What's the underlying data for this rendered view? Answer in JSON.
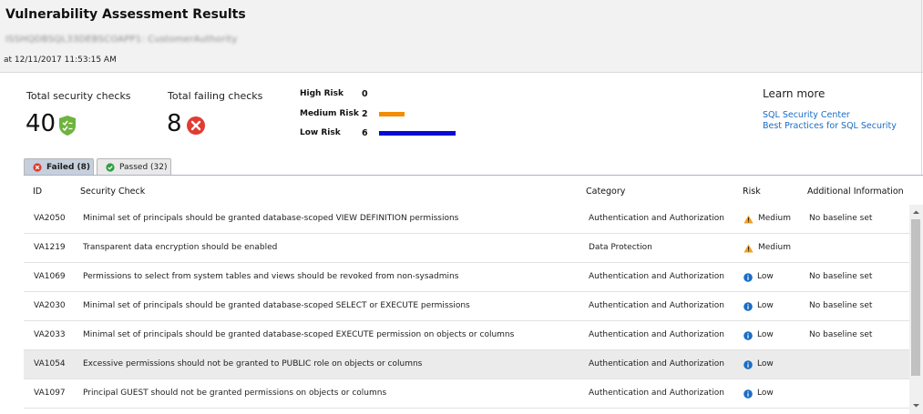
{
  "header": {
    "title": "Vulnerability Assessment Results",
    "server": "ISSHQDBSQL33DEBSCOAPP1: CustomerAuthority",
    "timestamp": "at 12/11/2017 11:53:15 AM"
  },
  "summary": {
    "total_label": "Total security checks",
    "total_value": "40",
    "failing_label": "Total failing checks",
    "failing_value": "8"
  },
  "risk_breakdown": [
    {
      "label": "High Risk",
      "count": "0",
      "value": 0,
      "color": "#e8862a"
    },
    {
      "label": "Medium Risk",
      "count": "2",
      "value": 2,
      "color": "#f28c00"
    },
    {
      "label": "Low Risk",
      "count": "6",
      "value": 6,
      "color": "#0a0ad6"
    }
  ],
  "learn_more": {
    "title": "Learn more",
    "links": [
      "SQL Security Center",
      "Best Practices for SQL Security"
    ]
  },
  "tabs": {
    "failed": "Failed (8)",
    "passed": "Passed (32)",
    "active": "failed"
  },
  "table": {
    "columns": {
      "id": "ID",
      "check": "Security Check",
      "category": "Category",
      "risk": "Risk",
      "info": "Additional Information"
    },
    "rows": [
      {
        "id": "VA2050",
        "check": "Minimal set of principals should be granted database-scoped VIEW DEFINITION permissions",
        "category": "Authentication and Authorization",
        "risk": "Medium",
        "risk_icon": "warning-icon",
        "info": "No baseline set"
      },
      {
        "id": "VA1219",
        "check": "Transparent data encryption should be enabled",
        "category": "Data Protection",
        "risk": "Medium",
        "risk_icon": "warning-icon",
        "info": ""
      },
      {
        "id": "VA1069",
        "check": "Permissions to select from system tables and views should be revoked from non-sysadmins",
        "category": "Authentication and Authorization",
        "risk": "Low",
        "risk_icon": "info-icon",
        "info": "No baseline set"
      },
      {
        "id": "VA2030",
        "check": "Minimal set of principals should be granted database-scoped SELECT or EXECUTE permissions",
        "category": "Authentication and Authorization",
        "risk": "Low",
        "risk_icon": "info-icon",
        "info": "No baseline set"
      },
      {
        "id": "VA2033",
        "check": "Minimal set of principals should be granted database-scoped EXECUTE permission on objects or columns",
        "category": "Authentication and Authorization",
        "risk": "Low",
        "risk_icon": "info-icon",
        "info": "No baseline set"
      },
      {
        "id": "VA1054",
        "check": "Excessive permissions should not be granted to PUBLIC role on objects or columns",
        "category": "Authentication and Authorization",
        "risk": "Low",
        "risk_icon": "info-icon",
        "info": ""
      },
      {
        "id": "VA1097",
        "check": "Principal GUEST should not be granted permissions on objects or columns",
        "category": "Authentication and Authorization",
        "risk": "Low",
        "risk_icon": "info-icon",
        "info": ""
      }
    ],
    "highlighted_row": 5
  },
  "colors": {
    "shield": "#6fb33f",
    "error": "#e03c31",
    "passed": "#2ea043",
    "warning": "#f0a020",
    "info": "#1a6dc4"
  }
}
